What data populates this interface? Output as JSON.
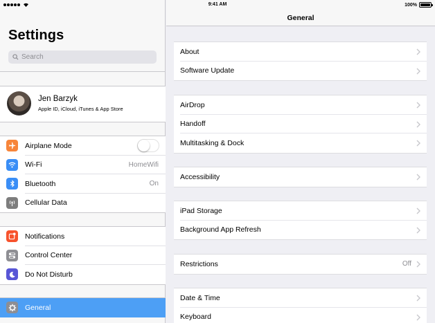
{
  "status_bar": {
    "time": "9:41 AM",
    "battery_pct": "100%",
    "battery_level": 1.0
  },
  "sidebar": {
    "title": "Settings",
    "search_placeholder": "Search",
    "profile": {
      "name": "Jen Barzyk",
      "subtitle": "Apple ID, iCloud, iTunes & App Store"
    },
    "group1": [
      {
        "label": "Airplane Mode",
        "icon": "airplane-icon",
        "color": "#f7853a",
        "toggle": false
      },
      {
        "label": "Wi-Fi",
        "icon": "wifi-icon",
        "color": "#3a8ef6",
        "value": "HomeWifi"
      },
      {
        "label": "Bluetooth",
        "icon": "bluetooth-icon",
        "color": "#3a8ef6",
        "value": "On"
      },
      {
        "label": "Cellular Data",
        "icon": "cellular-icon",
        "color": "#7d7d7d"
      }
    ],
    "group2": [
      {
        "label": "Notifications",
        "icon": "notifications-icon",
        "color": "#f7532d"
      },
      {
        "label": "Control Center",
        "icon": "control-center-icon",
        "color": "#8e8e93"
      },
      {
        "label": "Do Not Disturb",
        "icon": "moon-icon",
        "color": "#5856d6"
      }
    ],
    "group3": [
      {
        "label": "General",
        "icon": "gear-icon",
        "color": "#8e8e93",
        "selected": true
      }
    ]
  },
  "main": {
    "title": "General",
    "groups": [
      [
        {
          "label": "About"
        },
        {
          "label": "Software Update"
        }
      ],
      [
        {
          "label": "AirDrop"
        },
        {
          "label": "Handoff"
        },
        {
          "label": "Multitasking & Dock"
        }
      ],
      [
        {
          "label": "Accessibility"
        }
      ],
      [
        {
          "label": "iPad Storage"
        },
        {
          "label": "Background App Refresh"
        }
      ],
      [
        {
          "label": "Restrictions",
          "value": "Off"
        }
      ],
      [
        {
          "label": "Date & Time"
        },
        {
          "label": "Keyboard"
        }
      ]
    ]
  },
  "colors": {
    "accent": "#4d9ff5",
    "background": "#efeff4"
  }
}
